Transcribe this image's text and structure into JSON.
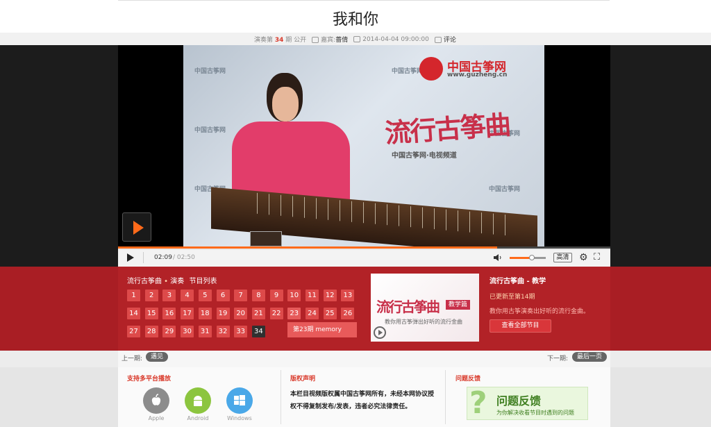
{
  "header": {
    "title": "我和你",
    "episode_prefix": "演奏第",
    "episode_number": "34",
    "episode_suffix": "期 公开",
    "guest_label": "嘉宾:",
    "guest_name": "蔷倩",
    "datetime": "2014-04-04 09:00:00",
    "comments_label": "评论"
  },
  "video": {
    "watermark_logo_text": "中国古筝网",
    "watermark_url": "www.guzheng.cn",
    "title_overlay": "流行古筝曲",
    "subtitle_overlay": "中国古筝网·电视频道",
    "corner_watermark": "中国古筝网",
    "big_play_icon": "play-icon"
  },
  "player_controls": {
    "current_time": "02:09",
    "total_time": "/ 02:50",
    "progress": 0.77,
    "volume": 0.6,
    "quality_label": "高清",
    "settings_icon": "gear-icon",
    "fullscreen_icon": "fullscreen-icon"
  },
  "episodes": {
    "series_name": "流行古筝曲",
    "category": "演奏",
    "list_label": "节目列表",
    "items": [
      "1",
      "2",
      "3",
      "4",
      "5",
      "6",
      "7",
      "8",
      "9",
      "10",
      "11",
      "12",
      "13",
      "14",
      "15",
      "16",
      "17",
      "18",
      "19",
      "20",
      "21",
      "22",
      "23",
      "24",
      "25",
      "26",
      "27",
      "28",
      "29",
      "30",
      "31",
      "32",
      "33",
      "34"
    ],
    "active": "34",
    "hovered": "23",
    "tooltip": "第23期 memory"
  },
  "promo": {
    "title_overlay": "流行古筝曲",
    "tag": "教学篇",
    "subtitle": "教你用古筝弹出好听的流行金曲",
    "play_icon": "play-circle-icon"
  },
  "series_info": {
    "title": "流行古筝曲 - 教学",
    "updated": "已更新至第14期",
    "description": "教你用古筝演奏出好听的流行金曲。",
    "view_all": "查看全部节目"
  },
  "navigation": {
    "prev_label": "上一期:",
    "prev_button": "遇见",
    "next_label": "下一期:",
    "next_button": "最后一页"
  },
  "footer": {
    "platform_title": "支持多平台播放",
    "apps": [
      {
        "label": "Apple",
        "icon": "apple-icon",
        "color": "#8c8c8c"
      },
      {
        "label": "Android",
        "icon": "android-icon",
        "color": "#8cc53f"
      },
      {
        "label": "Windows",
        "icon": "windows-icon",
        "color": "#4aa8e8"
      }
    ],
    "copyright_title": "版权声明",
    "copyright_text": "本栏目视频版权属中国古筝网所有，未经本网协议授权不得复制发布/发表，违者必究法律责任。",
    "feedback_title": "问题反馈",
    "feedback_banner_title": "问题反馈",
    "feedback_banner_sub": "为你解决收看节目时遇到的问题"
  },
  "colors": {
    "accent": "#ff6a1a",
    "brand_red": "#b22227",
    "episode_button": "#dd4a4a",
    "active_episode": "#303030"
  }
}
